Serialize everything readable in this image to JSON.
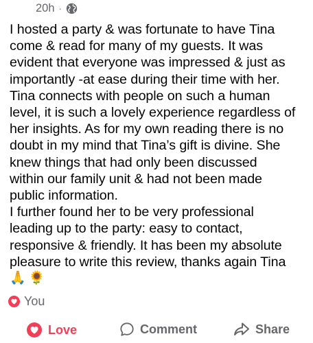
{
  "post": {
    "time": "20h",
    "separator": "·",
    "privacy_icon": "globe-icon",
    "paragraphs": [
      "I hosted a party & was fortunate to have Tina\ncome & read for many of my guests. It was\nevident that everyone was impressed & just as\nimportantly -at ease during their time with her.\nTina connects with people on such a human\nlevel, it is such a lovely experience regardless of\nher insights. As for my own reading there is no\ndoubt in my mind that Tina’s gift is divine. She\nknew things that had only been discussed\nwithin our family unit & had not been made\npublic information.",
      "I further found her to be very professional\nleading up to the party: easy to contact,\nresponsive & friendly. It has been my absolute\npleasure to write this review, thanks  again Tina"
    ],
    "emojis": [
      "🙏",
      "🌻"
    ]
  },
  "reactions": {
    "icon": "heart-icon",
    "label": "You"
  },
  "actions": {
    "love": "Love",
    "comment": "Comment",
    "share": "Share"
  },
  "colors": {
    "love": "#f33e58",
    "muted": "#65676b",
    "text": "#050505"
  }
}
